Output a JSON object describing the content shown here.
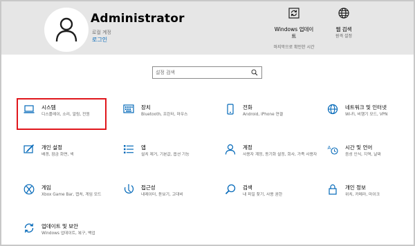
{
  "user": {
    "name": "Administrator",
    "account_type": "로컬 계정",
    "signin_link": "로그인"
  },
  "header_items": [
    {
      "icon": "windows-update-icon",
      "title": "Windows 업데이트",
      "sub": "마지막으로 확인한 시간"
    },
    {
      "icon": "globe-icon",
      "title": "웹 검색",
      "sub": "원격 설정"
    }
  ],
  "search": {
    "placeholder": "설정 검색"
  },
  "tiles": [
    {
      "name": "system",
      "icon": "laptop-icon",
      "title": "시스템",
      "desc": "디스플레이, 소리, 알림, 전원"
    },
    {
      "name": "devices",
      "icon": "keyboard-icon",
      "title": "장치",
      "desc": "Bluetooth, 프린터, 마우스"
    },
    {
      "name": "phone",
      "icon": "phone-icon",
      "title": "전화",
      "desc": "Android, iPhone 연결"
    },
    {
      "name": "network",
      "icon": "globe-network-icon",
      "title": "네트워크 및 인터넷",
      "desc": "Wi-Fi, 비행기 모드, VPN"
    },
    {
      "name": "personalization",
      "icon": "paint-brush-icon",
      "title": "개인 설정",
      "desc": "배경, 잠금 화면, 색"
    },
    {
      "name": "apps",
      "icon": "apps-list-icon",
      "title": "앱",
      "desc": "설치 제거, 기본값, 옵션 기능"
    },
    {
      "name": "accounts",
      "icon": "person-icon",
      "title": "계정",
      "desc": "사용자 계정, 동기화 설정, 회사, 가족 사용자"
    },
    {
      "name": "time-language",
      "icon": "time-language-icon",
      "title": "시간 및 언어",
      "desc": "음성 인식, 지역, 날짜"
    },
    {
      "name": "gaming",
      "icon": "xbox-icon",
      "title": "게임",
      "desc": "Xbox Game Bar, 캡처, 게임 모드"
    },
    {
      "name": "ease-of-access",
      "icon": "ease-of-access-icon",
      "title": "접근성",
      "desc": "내레이터, 돋보기, 고대비"
    },
    {
      "name": "search",
      "icon": "search-icon",
      "title": "검색",
      "desc": "내 파일 찾기, 사용 권한"
    },
    {
      "name": "privacy",
      "icon": "lock-icon",
      "title": "개인 정보",
      "desc": "위치, 카메라, 마이크"
    },
    {
      "name": "update-security",
      "icon": "update-sync-icon",
      "title": "업데이트 및 보안",
      "desc": "Windows 업데이트, 복구, 백업"
    }
  ],
  "colors": {
    "accent": "#0067b8",
    "highlight_border": "#e0151b",
    "header_bg": "#e6e6e6"
  }
}
